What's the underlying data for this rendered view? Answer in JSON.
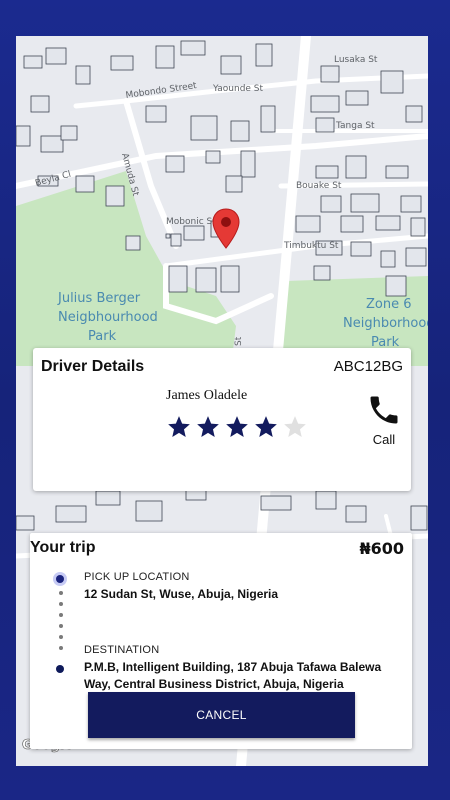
{
  "map": {
    "streets": [
      "Lusaka St",
      "Yaounde St",
      "Mobondo Street",
      "Tanga St",
      "Amuda St",
      "Beyla Cl",
      "Bouake St",
      "Mobonic St",
      "Timbuktu St"
    ],
    "parks": {
      "left": [
        "Julius Berger",
        "Neigbhourhood",
        "Park"
      ],
      "right": [
        "Zone 6",
        "Neighborhood",
        "Park"
      ]
    },
    "lower_streets": [
      "Igiyara St"
    ],
    "pin_icon": "map-pin-icon",
    "attribution": "Google"
  },
  "driver": {
    "title": "Driver Details",
    "plate": "ABC12BG",
    "name": "James Oladele",
    "rating": 4,
    "rating_max": 5,
    "call_label": "Call",
    "call_icon": "phone-icon"
  },
  "trip": {
    "title": "Your trip",
    "price": "₦600",
    "pickup_label": "PICK UP LOCATION",
    "pickup_address": "12 Sudan St, Wuse, Abuja, Nigeria",
    "destination_label": "DESTINATION",
    "destination_address": "P.M.B, Intelligent Building, 187 Abuja Tafawa Balewa Way, Central Business District, Abuja, Nigeria",
    "cancel_label": "CANCEL"
  },
  "colors": {
    "background": "#1b2a8f",
    "accent": "#131b5e",
    "star_filled": "#131b5e",
    "star_empty": "#e0e0e0",
    "park": "#c8e6c0",
    "pin": "#e53935"
  }
}
